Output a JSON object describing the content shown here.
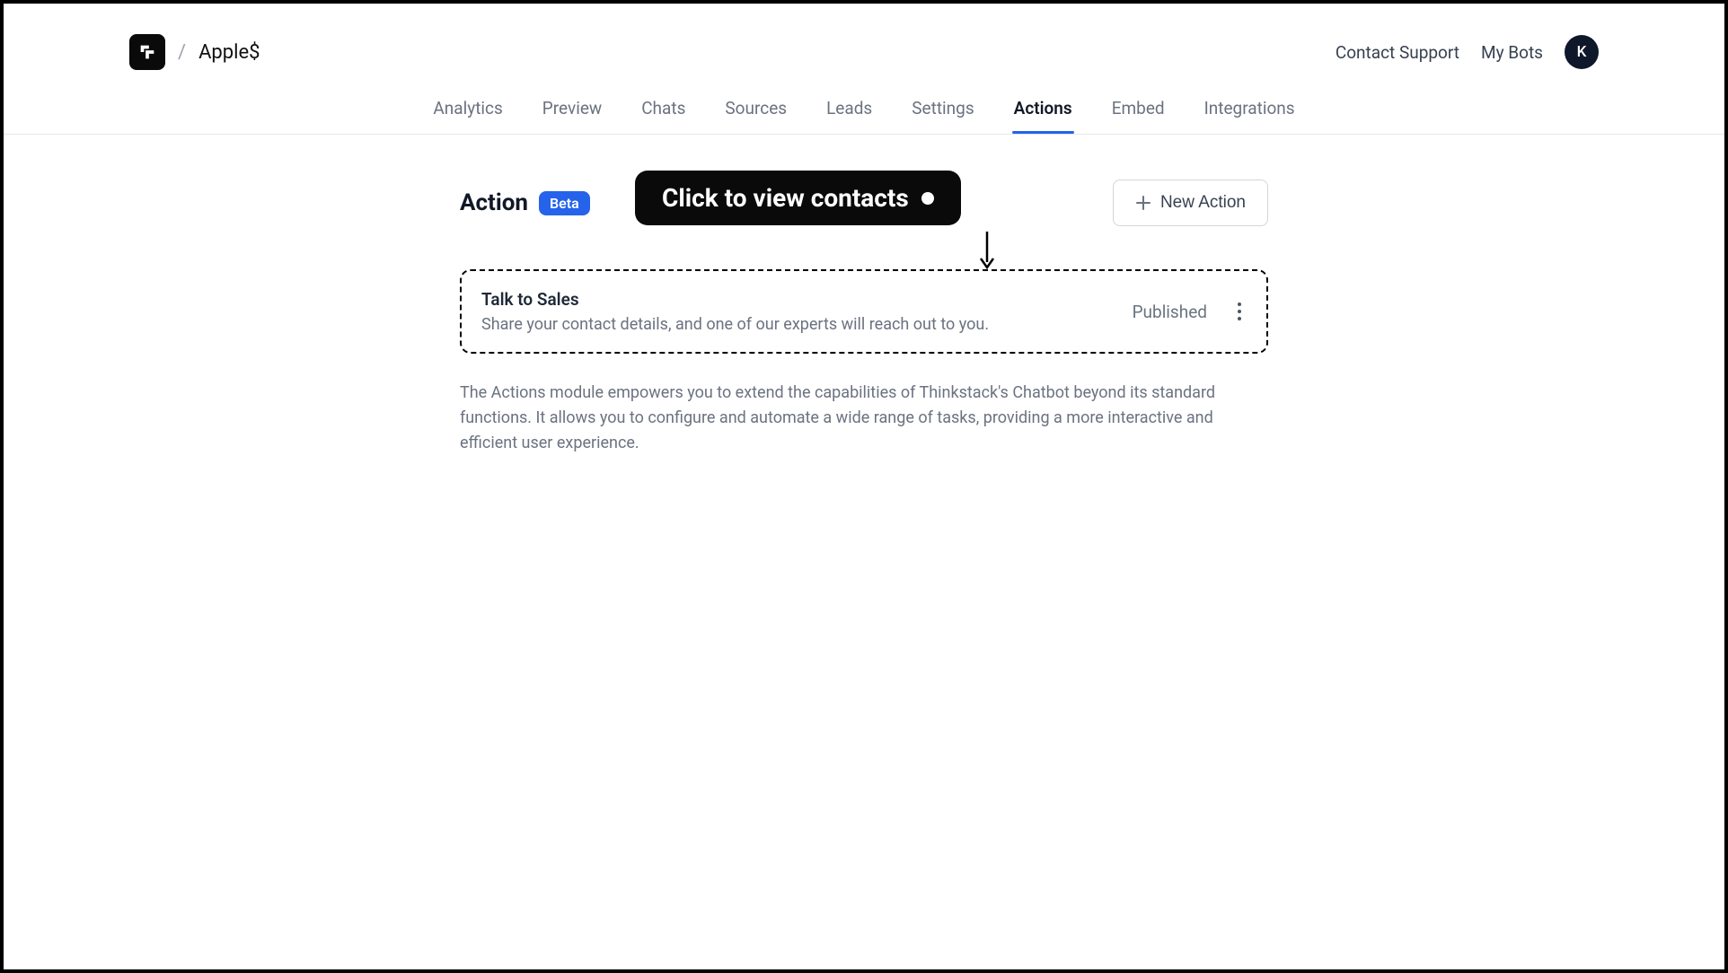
{
  "header": {
    "breadcrumb_separator": "/",
    "bot_name": "Apple$",
    "contact_support": "Contact Support",
    "my_bots": "My Bots",
    "avatar_initial": "K"
  },
  "tabs": [
    {
      "label": "Analytics",
      "active": false
    },
    {
      "label": "Preview",
      "active": false
    },
    {
      "label": "Chats",
      "active": false
    },
    {
      "label": "Sources",
      "active": false
    },
    {
      "label": "Leads",
      "active": false
    },
    {
      "label": "Settings",
      "active": false
    },
    {
      "label": "Actions",
      "active": true
    },
    {
      "label": "Embed",
      "active": false
    },
    {
      "label": "Integrations",
      "active": false
    }
  ],
  "page": {
    "title": "Action",
    "badge": "Beta",
    "new_action_label": "New Action",
    "tooltip_text": "Click to view contacts"
  },
  "actions": [
    {
      "title": "Talk to Sales",
      "description": "Share your contact details, and one of our experts will reach out to you.",
      "status": "Published"
    }
  ],
  "info_text": "The Actions module empowers you to extend the capabilities of Thinkstack's Chatbot beyond its standard functions. It allows you to configure and automate a wide range of tasks, providing a more interactive and efficient user experience."
}
